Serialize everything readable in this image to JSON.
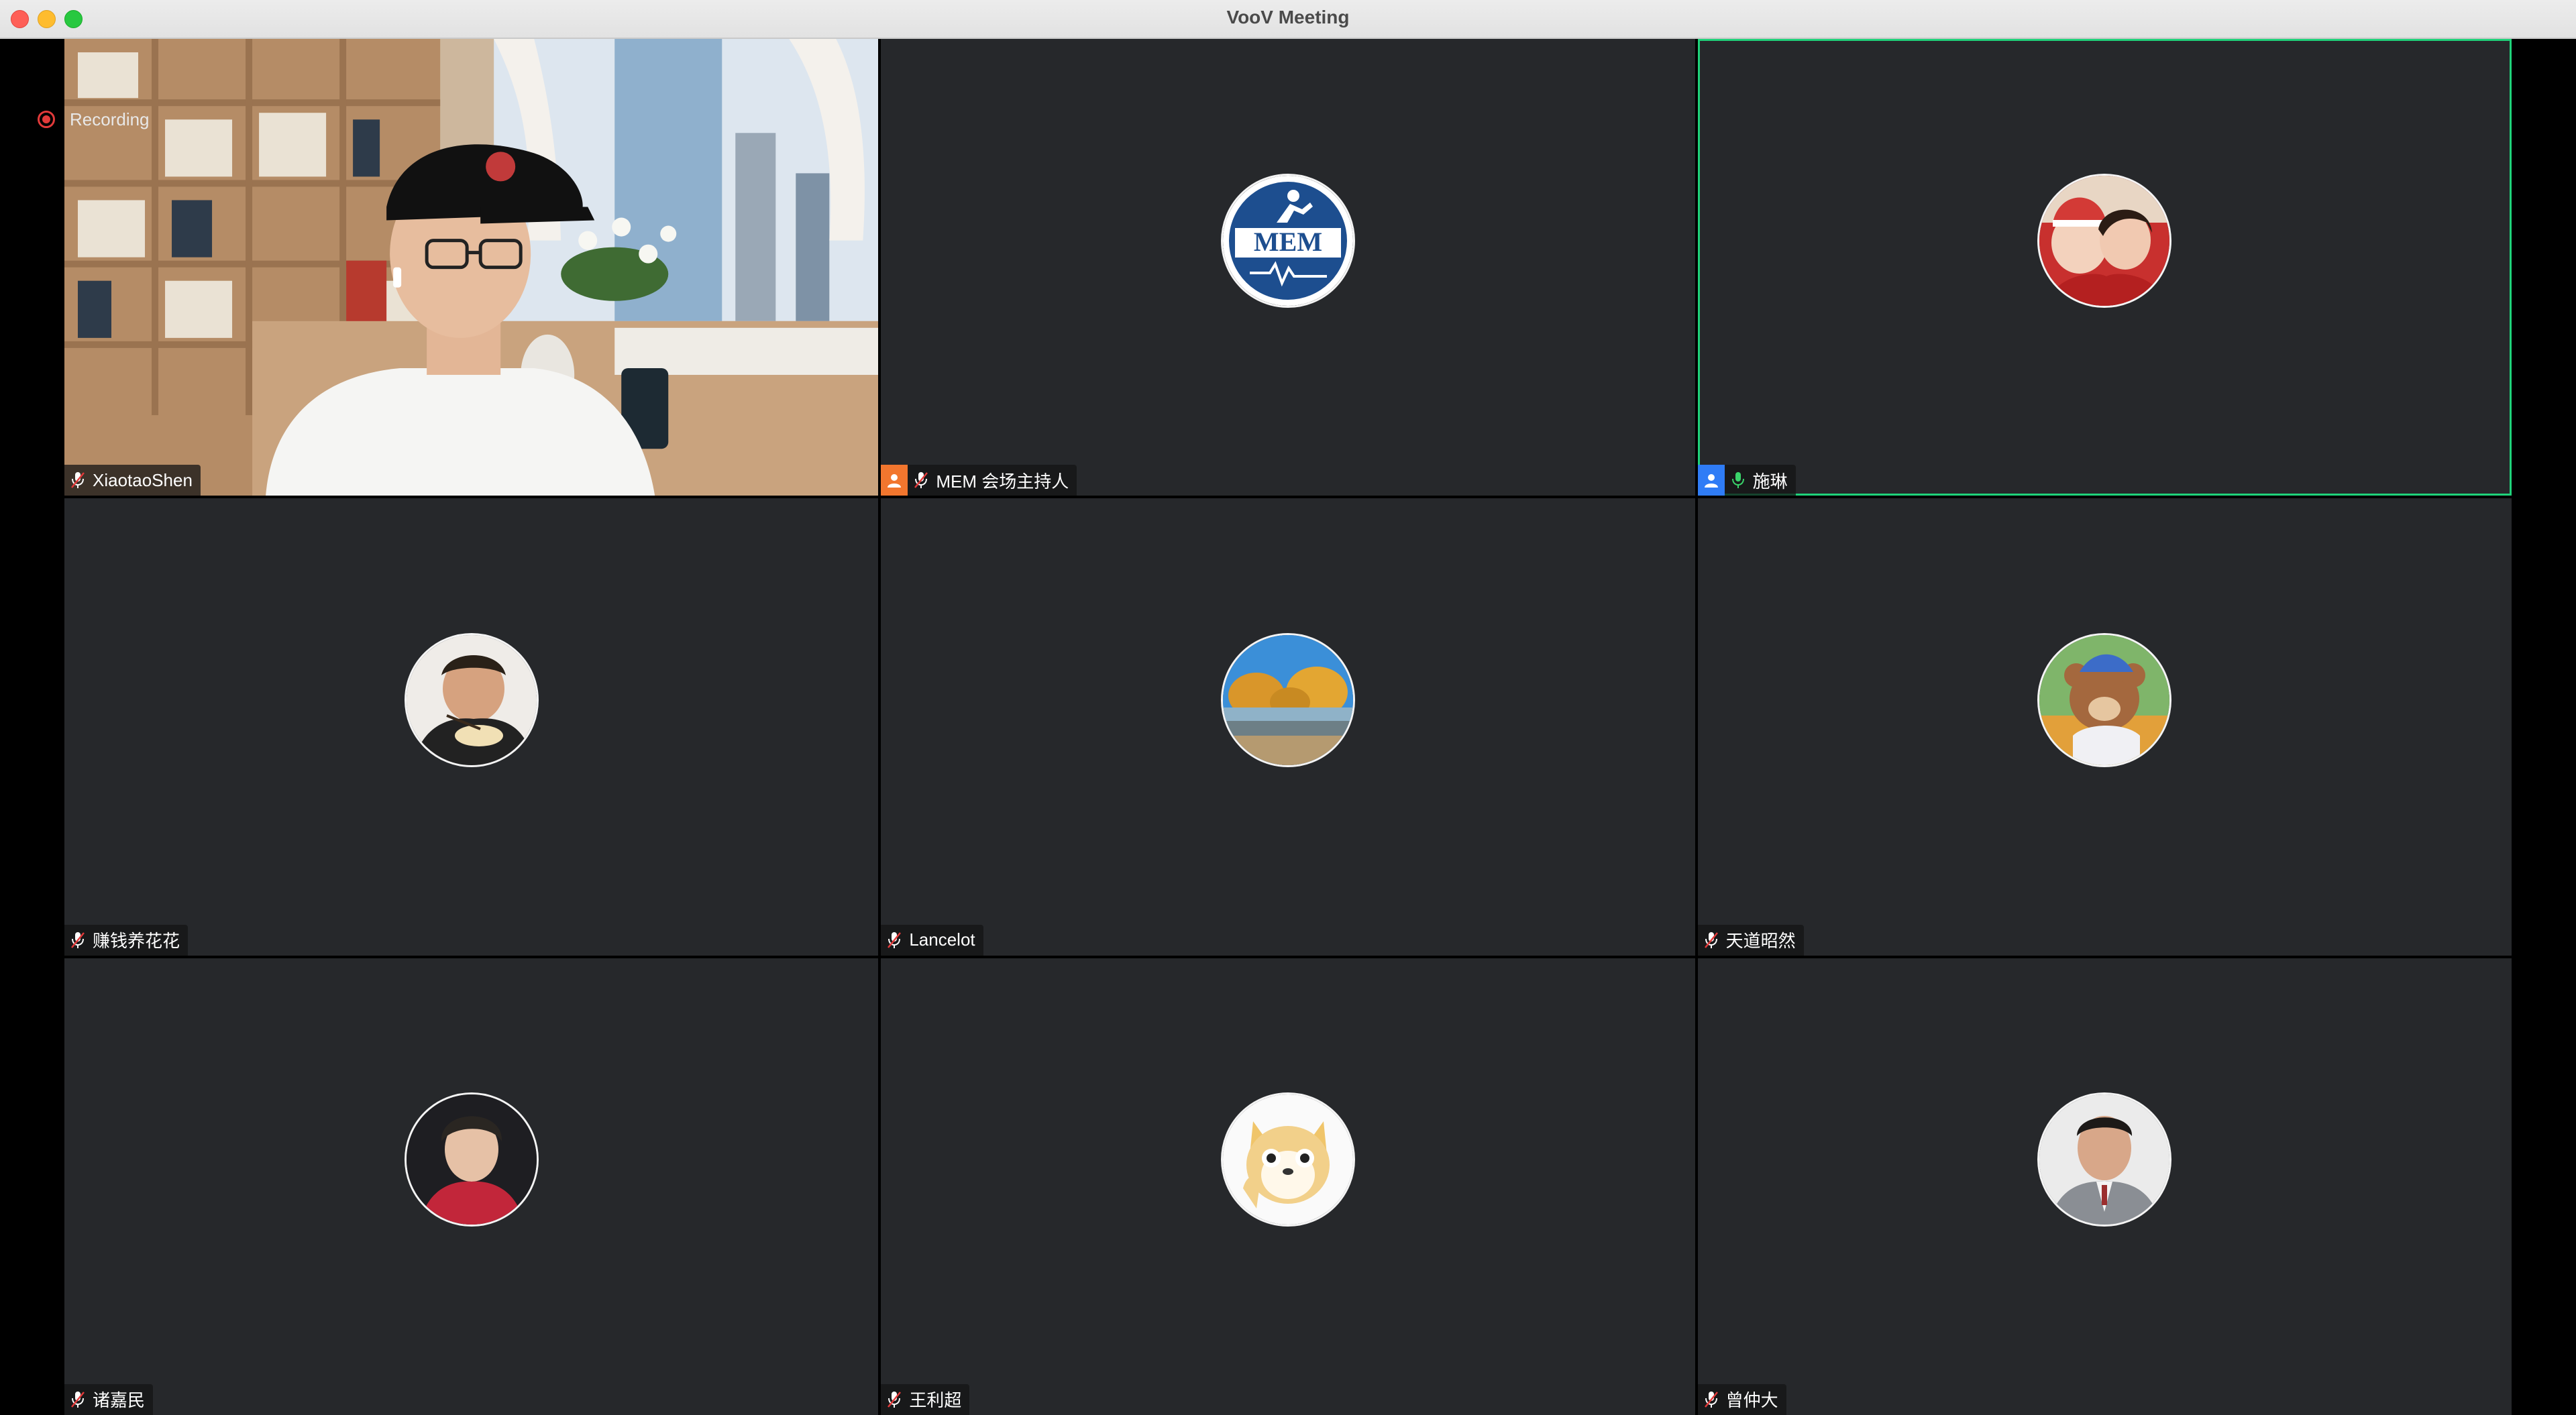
{
  "window": {
    "title": "VooV Meeting"
  },
  "recording": {
    "label": "Recording"
  },
  "participants": [
    {
      "name": "XiaotaoShen",
      "mic": "muted",
      "video": true
    },
    {
      "name": "MEM 会场主持人",
      "mic": "muted",
      "role": "host",
      "avatar": "mem-logo"
    },
    {
      "name": "施琳",
      "mic": "on",
      "role": "co-host",
      "active_speaker": true,
      "avatar": "mother-child-photo"
    },
    {
      "name": "赚钱养花花",
      "mic": "muted",
      "avatar": "man-eating-photo"
    },
    {
      "name": "Lancelot",
      "mic": "muted",
      "avatar": "desert-trees-photo"
    },
    {
      "name": "天道昭然",
      "mic": "muted",
      "avatar": "teddy-bear-photo"
    },
    {
      "name": "诸嘉民",
      "mic": "muted",
      "avatar": "young-man-red-sweater-photo"
    },
    {
      "name": "王利超",
      "mic": "muted",
      "avatar": "cartoon-dog"
    },
    {
      "name": "曾仲大",
      "mic": "muted",
      "avatar": "man-in-suit-photo"
    }
  ],
  "logo": {
    "text": "MEM"
  },
  "colors": {
    "tile_bg": "#26282b",
    "active_border": "#1fd27a",
    "host_badge": "#f2762e",
    "cohost_badge": "#2f7cf6",
    "mic_on": "#3ad46a",
    "recording": "#e23a3a"
  }
}
